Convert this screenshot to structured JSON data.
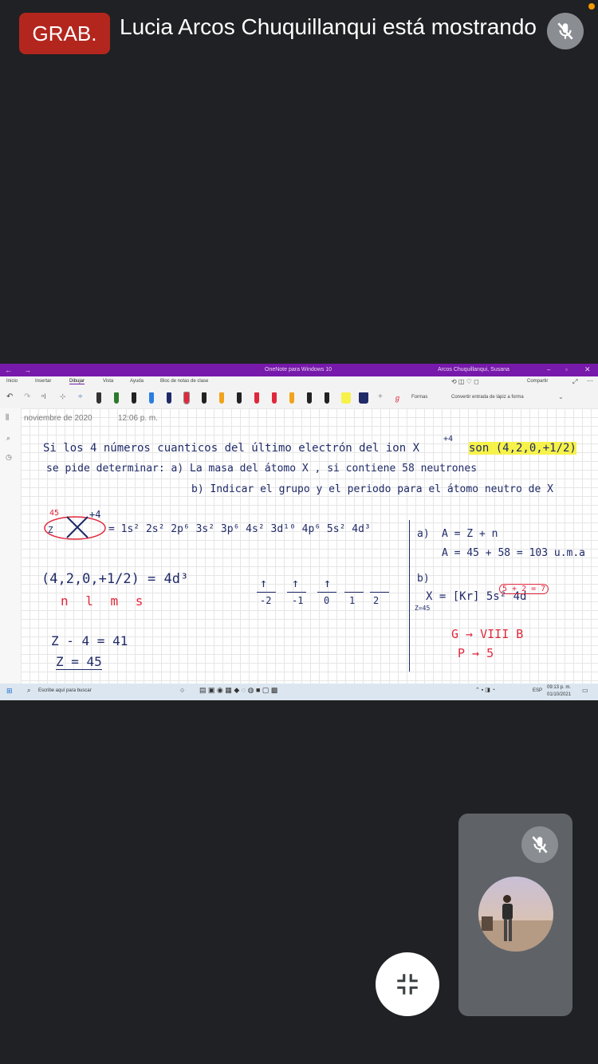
{
  "meeting": {
    "rec_label": "GRAB.",
    "presenter_text": "Lucia Arcos Chuquillanqui está mostrando s",
    "icons": {
      "top_mic": "mic-off-icon",
      "self_mic": "mic-off-icon",
      "fab": "minimize-icon"
    }
  },
  "onenote": {
    "window_title": "OneNote para Windows 10",
    "user": "Arcos Chuquillanqui, Susana",
    "menu": [
      "Inicio",
      "Insertar",
      "Dibujar",
      "Vista",
      "Ayuda",
      "Bloc de notas de clase"
    ],
    "share_label": "Compartir",
    "shapes_label": "Formas",
    "ink_to_shape_label": "Convertir entrada de lápiz a forma",
    "page_date": "noviembre de 2020",
    "page_time": "12:06 p. m."
  },
  "notes": {
    "line1": "Si los 4 números cuanticos del último electrón del ion X",
    "line1_sup": "+4",
    "line1_tail": "son (4,2,0,+1/2)",
    "line2": "se pide determinar:  a) La masa del átomo X , si contiene 58 neutrones",
    "line3": "b) Indicar el grupo y el periodo para el átomo neutro de X",
    "z_label": "Z",
    "z_value": "45",
    "charge": "+4",
    "config": "= 1s² 2s² 2p⁶ 3s² 3p⁶ 4s² 3d¹⁰ 4p⁶ 5s² 4d³",
    "quantum": "(4,2,0,+1/2) = 4d³",
    "nlms": "n l m s",
    "orbitals": [
      "-2",
      "-1",
      "0",
      "1",
      "2"
    ],
    "eq1": "Z - 4 = 41",
    "eq2": "Z = 45",
    "ans_a": "a)",
    "ans_a1": "A = Z + n",
    "ans_a2": "A = 45 + 58 = 103 u.m.a",
    "ans_b": "b)",
    "ans_b_expr": "X = [Kr] 5s² 4d",
    "ans_b_sup": "5 + 2 = 7",
    "ans_z": "Z=45",
    "ans_g": "G → VIII B",
    "ans_p": "P → 5"
  },
  "taskbar": {
    "search_placeholder": "Escribe aquí para buscar",
    "lang": "ESP",
    "time": "09:13 p. m.",
    "date": "01/10/2021"
  },
  "colors": {
    "background": "#202124",
    "rec": "#b3261e",
    "onenote_purple": "#7719aa",
    "ink_blue": "#1f2a68",
    "ink_red": "#e0283c",
    "highlight": "#f7f24a"
  }
}
